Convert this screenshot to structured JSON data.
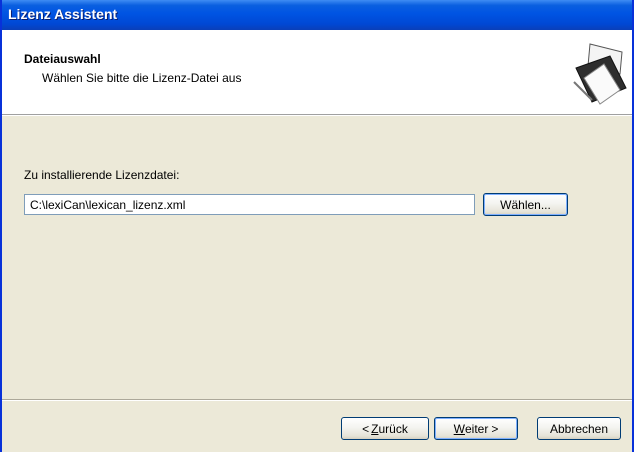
{
  "window": {
    "title": "Lizenz Assistent"
  },
  "header": {
    "title": "Dateiauswahl",
    "subtitle": "Wählen Sie bitte die Lizenz-Datei aus",
    "icon": "document-certificate-icon"
  },
  "content": {
    "field_label": "Zu installierende Lizenzdatei:",
    "license_path": "C:\\lexiCan\\lexican_lizenz.xml",
    "browse_label": "Wählen..."
  },
  "footer": {
    "back_prefix": "<",
    "back_mnemonic": "Z",
    "back_rest": "urück",
    "next_mnemonic": "W",
    "next_rest": "eiter",
    "next_suffix": ">",
    "cancel_label": "Abbrechen"
  }
}
